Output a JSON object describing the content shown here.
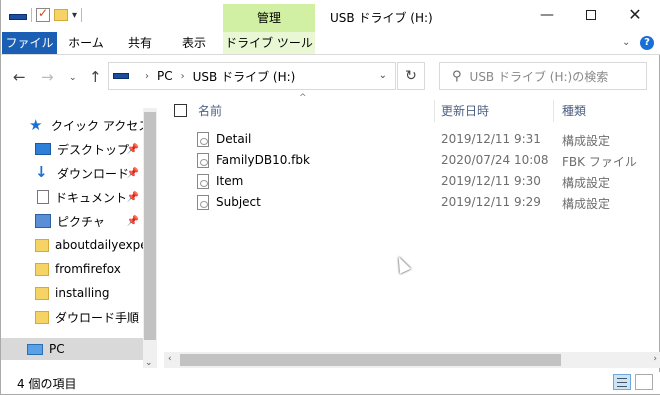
{
  "window": {
    "title": "USB ドライブ (H:)",
    "context_tab_group": "管理",
    "controls": {
      "minimize": "—",
      "close": "✕"
    }
  },
  "ribbon": {
    "tabs": [
      "ファイル",
      "ホーム",
      "共有",
      "表示",
      "ドライブ ツール"
    ],
    "help": "?",
    "collapse": "⌄"
  },
  "address": {
    "crumbs": [
      "PC",
      "USB ドライブ (H:)"
    ],
    "search_placeholder": "USB ドライブ (H:)の検索",
    "icons": {
      "back": "arrow-left-icon",
      "forward": "arrow-right-icon",
      "up": "arrow-up-icon",
      "refresh": "refresh-icon",
      "search": "search-icon"
    }
  },
  "nav": {
    "items": [
      {
        "label": "クイック アクセス",
        "icon": "star-icon",
        "pinned": false
      },
      {
        "label": "デスクトップ",
        "icon": "desktop-icon",
        "pinned": true
      },
      {
        "label": "ダウンロード",
        "icon": "download-icon",
        "pinned": true
      },
      {
        "label": "ドキュメント",
        "icon": "document-icon",
        "pinned": true
      },
      {
        "label": "ピクチャ",
        "icon": "pictures-icon",
        "pinned": true
      },
      {
        "label": "aboutdailyexper",
        "icon": "folder-icon",
        "pinned": false
      },
      {
        "label": "fromfirefox",
        "icon": "folder-icon",
        "pinned": false
      },
      {
        "label": "installing",
        "icon": "folder-icon",
        "pinned": false
      },
      {
        "label": "ダウロード手順",
        "icon": "folder-icon",
        "pinned": false
      },
      {
        "label": "PC",
        "icon": "pc-icon",
        "pinned": false,
        "selected": true
      }
    ]
  },
  "list": {
    "headers": {
      "name": "名前",
      "date": "更新日時",
      "type": "種類"
    },
    "rows": [
      {
        "name": "Detail",
        "date": "2019/12/11 9:31",
        "type": "構成設定"
      },
      {
        "name": "FamilyDB10.fbk",
        "date": "2020/07/24 10:08",
        "type": "FBK ファイル"
      },
      {
        "name": "Item",
        "date": "2019/12/11 9:30",
        "type": "構成設定"
      },
      {
        "name": "Subject",
        "date": "2019/12/11 9:29",
        "type": "構成設定"
      }
    ]
  },
  "status": {
    "count": "4 個の項目"
  },
  "colors": {
    "file_tab": "#1a5fb4",
    "context_tab": "#d2f0a4",
    "header_text": "#4d6082"
  }
}
